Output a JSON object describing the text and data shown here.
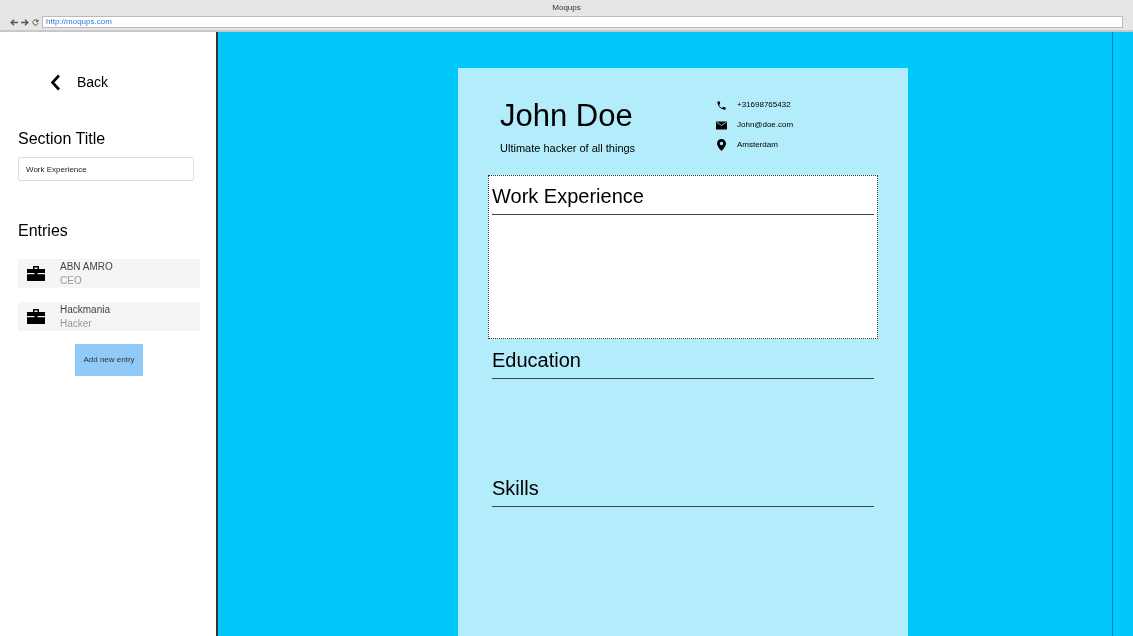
{
  "window": {
    "title": "Moqups",
    "url": "http://moqups.com"
  },
  "sidebar": {
    "back": "Back",
    "section_title_label": "Section Title",
    "section_title_value": "Work Experience",
    "entries_label": "Entries",
    "entries": [
      {
        "title": "ABN AMRO",
        "subtitle": "CEO"
      },
      {
        "title": "Hackmania",
        "subtitle": "Hacker"
      }
    ],
    "add_button": "Add new entry"
  },
  "resume": {
    "name": "John Doe",
    "tagline": "Ultimate hacker of all things",
    "contacts": [
      {
        "kind": "phone",
        "text": "+31698765432"
      },
      {
        "kind": "email",
        "text": "John@doe.com"
      },
      {
        "kind": "location",
        "text": "Amsterdam"
      }
    ],
    "sections": [
      {
        "title": "Work Experience",
        "selected": true
      },
      {
        "title": "Education",
        "selected": false
      },
      {
        "title": "Skills",
        "selected": false
      }
    ]
  }
}
